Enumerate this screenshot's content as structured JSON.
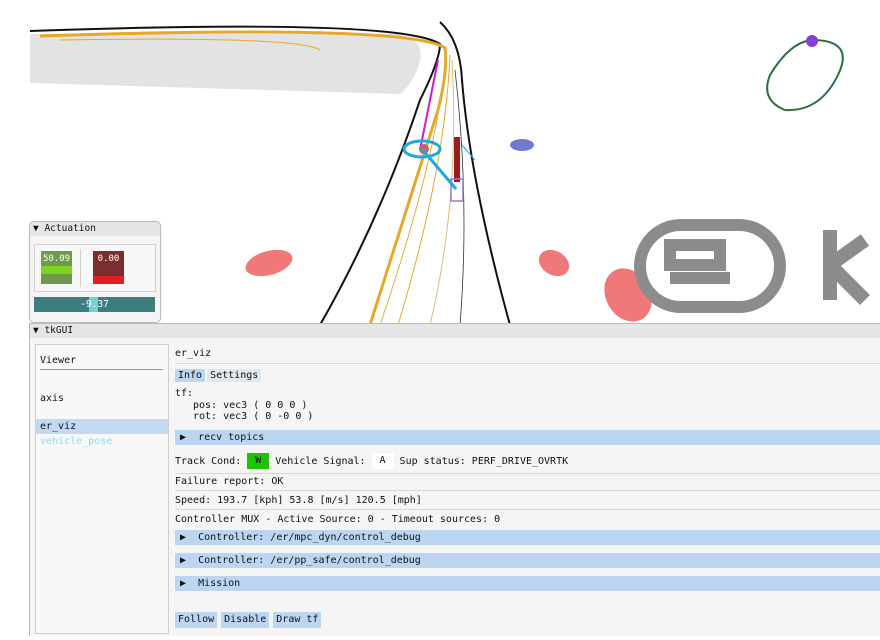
{
  "actuation": {
    "title": "Actuation",
    "throttle_value": "50.09",
    "brake_value": "0.00",
    "steering_value": "-9.37"
  },
  "gui": {
    "title": "tkGUI",
    "tree": {
      "header": "Viewer",
      "items": [
        "axis",
        "er_viz",
        "vehicle_pose"
      ]
    },
    "node_name": "er_viz",
    "tabs": [
      "Info",
      "Settings"
    ],
    "tf_label": "tf:",
    "tf_pos": "pos: vec3 ( 0 0 0 )",
    "tf_rot": "rot: vec3 ( 0 -0 0 )",
    "recv_topics": "recv topics",
    "track_cond_label": "Track Cond:",
    "track_cond_value": "W",
    "vehicle_signal_label": "Vehicle Signal:",
    "vehicle_signal_value": "A",
    "sup_status": "Sup status: PERF_DRIVE_OVRTK",
    "failure_report": "Failure report: OK",
    "speed": "Speed: 193.7 [kph] 53.8 [m/s] 120.5 [mph]",
    "controller_mux": "Controller MUX - Active Source: 0 - Timeout sources: 0",
    "controllers": [
      "Controller: /er/mpc_dyn/control_debug",
      "Controller: /er/pp_safe/control_debug"
    ],
    "mission": "Mission",
    "buttons": [
      "Follow",
      "Disable",
      "Draw tf"
    ]
  },
  "colors": {
    "panel_bg": "#f5f5f5",
    "header_blue": "#bcd6f1",
    "track_gray": "#e6e6e6",
    "cone_red": "#f07878",
    "path_orange": "#e7a72a",
    "trajectory_cyan": "#20a9e0",
    "vehicle_red": "#9b1c1c",
    "logo_gray": "#8c8c8c"
  }
}
